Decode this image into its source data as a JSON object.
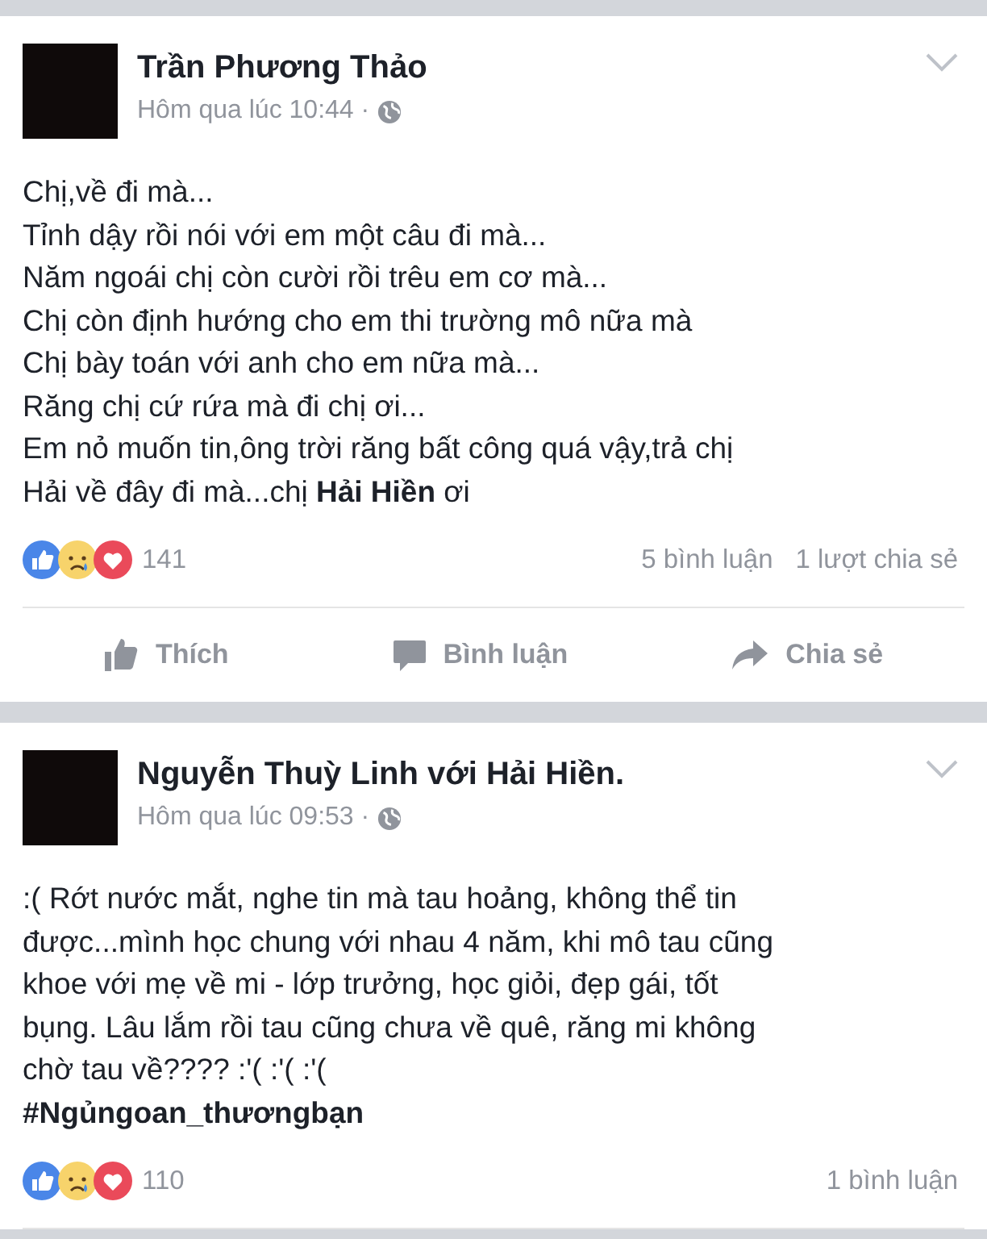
{
  "posts": [
    {
      "author": "Trần Phương Thảo",
      "time": "Hôm qua lúc 10:44 ·",
      "body": [
        "Chị,về đi mà...",
        "Tỉnh dậy rồi nói với em một câu đi mà...",
        "Năm ngoái chị còn cười rồi trêu em cơ mà...",
        "Chị còn định hướng cho em thi trường mô nữa mà",
        "Chị bày toán với anh cho em nữa mà...",
        "Răng chị cứ rứa mà đi chị ơi...",
        "Em nỏ muốn tin,ông trời răng bất công quá vậy,trả chị",
        "Hải về đây đi mà...chị **Hải Hiền** ơi"
      ],
      "reaction_count": "141",
      "stats": [
        "5 bình luận",
        "1 lượt chia sẻ"
      ],
      "actions": [
        {
          "kind": "like",
          "label": "Thích"
        },
        {
          "kind": "comment",
          "label": "Bình luận"
        },
        {
          "kind": "share",
          "label": "Chia sẻ"
        }
      ]
    },
    {
      "author": "Nguyễn Thuỳ Linh với Hải Hiền.",
      "time": "Hôm qua lúc 09:53 ·",
      "body": [
        ":( Rớt nước mắt, nghe tin mà tau hoảng, không thể tin",
        "được...mình học chung với nhau 4 năm, khi mô tau cũng",
        "khoe với mẹ về mi - lớp trưởng, học giỏi, đẹp gái, tốt",
        "bụng. Lâu lắm rồi tau cũng chưa về quê, răng mi không",
        "chờ tau về???? :'( :'( :'(",
        "**#Ngủngoan_thươngbạn**"
      ],
      "reaction_count": "110",
      "stats": [
        "1 bình luận"
      ]
    }
  ]
}
